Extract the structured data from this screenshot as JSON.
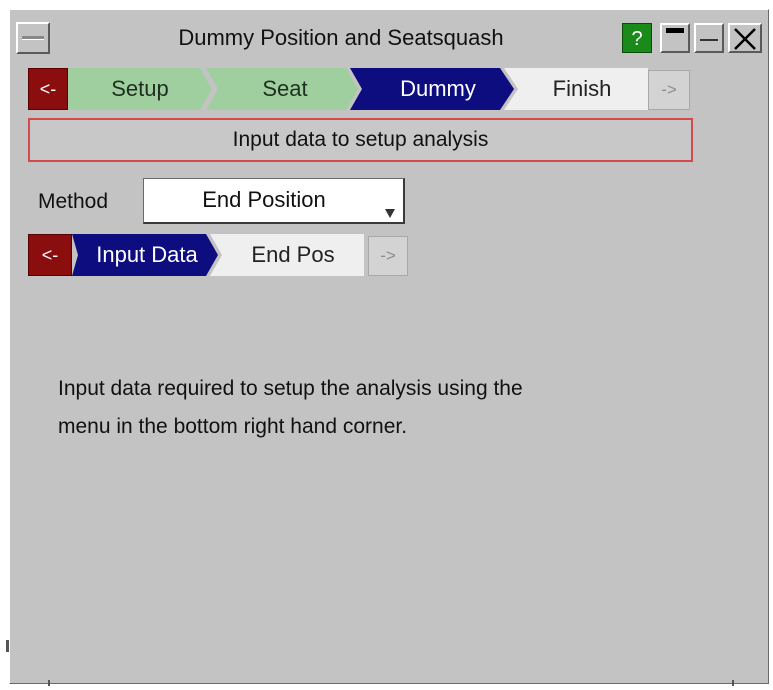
{
  "window": {
    "title": "Dummy Position and Seatsquash",
    "help_label": "?",
    "close_label": "X"
  },
  "wizard": {
    "back_label": "<-",
    "next_label": "->",
    "steps": [
      {
        "label": "Setup",
        "state": "done"
      },
      {
        "label": "Seat",
        "state": "done"
      },
      {
        "label": "Dummy",
        "state": "active"
      },
      {
        "label": "Finish",
        "state": "todo"
      }
    ]
  },
  "message": "Input data to setup analysis",
  "method": {
    "label": "Method",
    "value": "End Position"
  },
  "substeps": {
    "back_label": "<-",
    "next_label": "->",
    "items": [
      {
        "label": "Input Data",
        "state": "active"
      },
      {
        "label": "End Pos",
        "state": "todo"
      }
    ]
  },
  "info": {
    "line1": "Input data required to setup the analysis using the",
    "line2": "menu in the bottom right hand corner."
  },
  "colors": {
    "panel": "#c3c3c3",
    "step_done": "#9fcf9f",
    "step_active": "#0d0d80",
    "step_todo": "#efefef",
    "back_button": "#8b0e0e",
    "help_button": "#1a8a1a",
    "message_border": "#d24a4a"
  }
}
